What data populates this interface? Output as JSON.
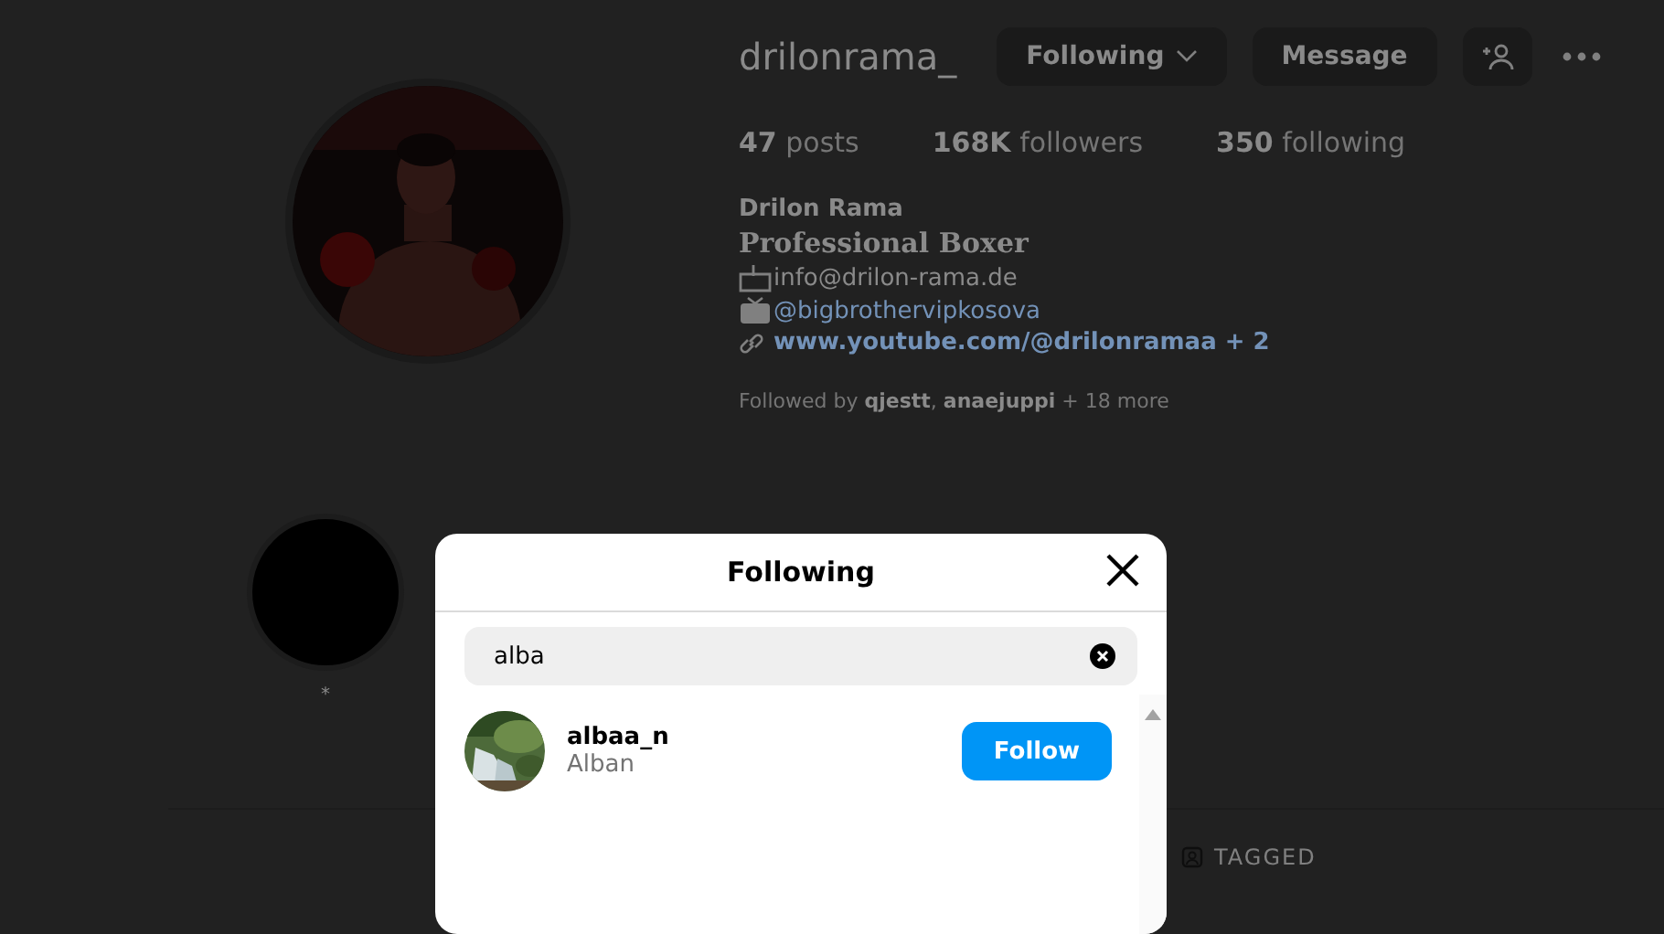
{
  "profile": {
    "username": "drilonrama_",
    "buttons": [
      {
        "label": "Following",
        "kind": "dropdown"
      },
      {
        "label": "Message",
        "kind": "plain"
      }
    ],
    "stats": [
      {
        "count": "47",
        "label": "posts"
      },
      {
        "count": "168K",
        "label": "followers"
      },
      {
        "count": "350",
        "label": "following"
      }
    ],
    "name": "Drilon Rama",
    "bio": [
      {
        "kind": "title",
        "text": "Professional Boxer"
      },
      {
        "kind": "mail",
        "text": "info@drilon-rama.de"
      },
      {
        "kind": "tv",
        "text": "@bigbrothervipkosova"
      },
      {
        "kind": "link",
        "text": "www.youtube.com/@drilonramaa + 2"
      }
    ],
    "followed_by": "Followed by **qjestt**, **anaejuppi** + 18 more",
    "highlights": [
      {
        "title": "*"
      }
    ],
    "tabs": [
      {
        "label": "TAGGED"
      }
    ]
  },
  "modal": {
    "title": "Following",
    "search": {
      "value": "alba"
    },
    "results": [
      {
        "username": "albaa_n",
        "name": "Alban",
        "button": "Follow"
      }
    ]
  }
}
